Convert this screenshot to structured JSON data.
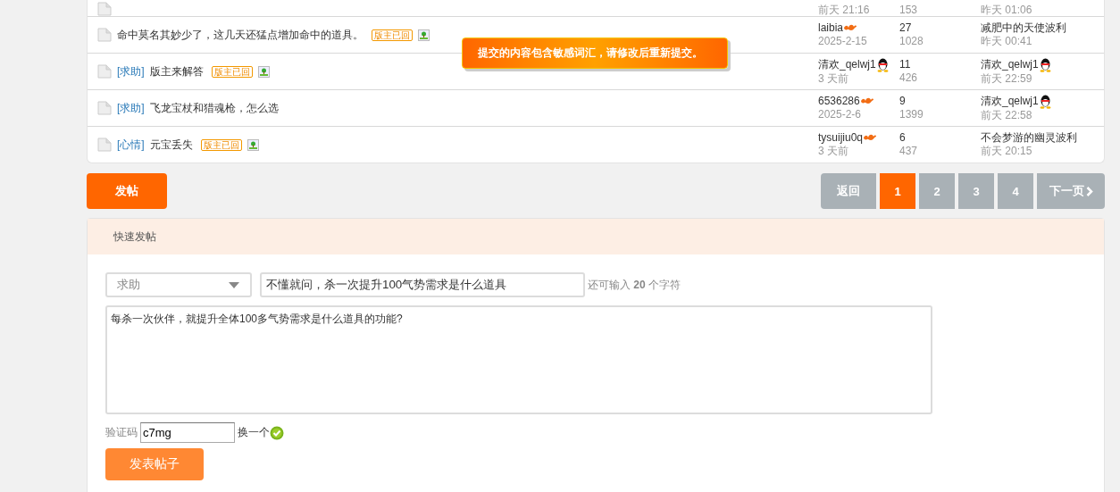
{
  "threads": [
    {
      "date": "前天 21:16",
      "views": "153",
      "last_time": "昨天 01:06"
    },
    {
      "title": "命中莫名其妙少了，这几天还猛点增加命中的道具。",
      "badge": "版主已回",
      "has_image": true,
      "author": "laibia",
      "author_icon": {
        "kind": "flame"
      },
      "date": "2025-2-15",
      "replies": "27",
      "views": "1028",
      "last_poster": "减肥中的天使波利",
      "last_time": "昨天 00:41"
    },
    {
      "tag": "[求助]",
      "title": "版主来解答",
      "badge": "版主已回",
      "has_image": true,
      "author": "清欢_qelwj1",
      "author_icon": {
        "kind": "qq"
      },
      "date": "3 天前",
      "replies": "11",
      "views": "426",
      "last_poster": "清欢_qelwj1",
      "last_poster_icon": {
        "kind": "qq"
      },
      "last_time": "前天 22:59"
    },
    {
      "tag": "[求助]",
      "title": "飞龙宝杖和猎魂枪，怎么选",
      "has_image": false,
      "author": "6536286",
      "author_icon": {
        "kind": "flame"
      },
      "date": "2025-2-6",
      "replies": "9",
      "views": "1399",
      "last_poster": "清欢_qelwj1",
      "last_poster_icon": {
        "kind": "qq"
      },
      "last_time": "前天 22:58"
    },
    {
      "tag": "[心情]",
      "title": "元宝丢失",
      "badge": "版主已回",
      "has_image": true,
      "author": "tysuijiu0q",
      "author_icon": {
        "kind": "flame"
      },
      "date": "3 天前",
      "replies": "6",
      "views": "437",
      "last_poster": "不会梦游的幽灵波利",
      "last_time": "前天 20:15"
    }
  ],
  "toast": {
    "message": "提交的内容包含敏感词汇，请修改后重新提交。"
  },
  "post_button": "发帖",
  "pagination": {
    "back": "返回",
    "pages": [
      {
        "label": "1",
        "selected": true
      },
      {
        "label": "2",
        "selected": false
      },
      {
        "label": "3",
        "selected": false
      },
      {
        "label": "4",
        "selected": false
      }
    ],
    "next": "下一页"
  },
  "quick_post": {
    "title": "快速发帖",
    "category": "求助",
    "subject": "不懂就问，杀一次提升100气势需求是什么道具",
    "counter": "还可输入 **20** 个字符",
    "body": "每杀一次伙伴，就提升全体100多气势需求是什么道具的功能?",
    "captcha_label": "验证码",
    "captcha": "c7mg",
    "captcha_refresh": "换一个",
    "captcha_ok": true,
    "submit": "发表帖子"
  }
}
